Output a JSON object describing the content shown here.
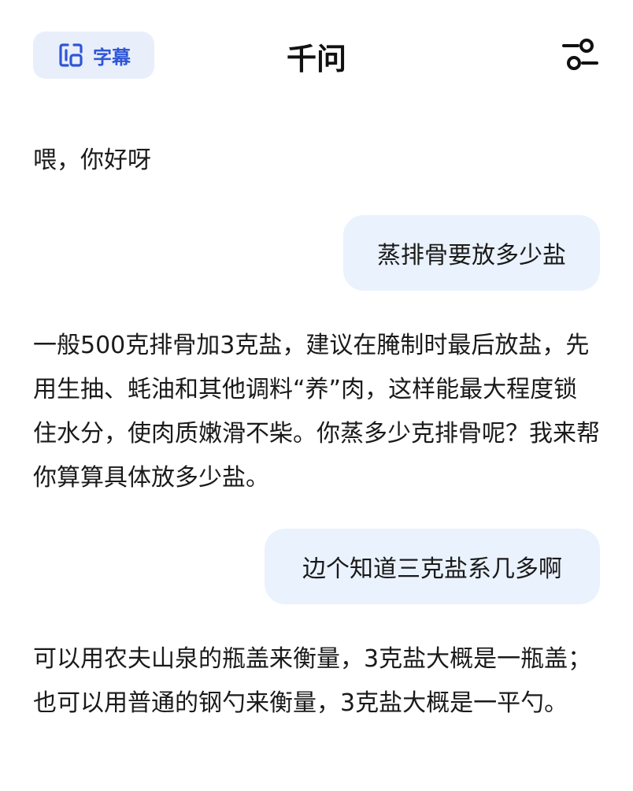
{
  "header": {
    "subtitle_label": "字幕",
    "title": "千问"
  },
  "messages": [
    {
      "role": "assistant",
      "text": "喂，你好呀"
    },
    {
      "role": "user",
      "text": "蒸排骨要放多少盐"
    },
    {
      "role": "assistant",
      "text": "一般500克排骨加3克盐，建议在腌制时最后放盐，先用生抽、蚝油和其他调料“养”肉，这样能最大程度锁住水分，使肉质嫩滑不柴。你蒸多少克排骨呢？我来帮你算算具体放多少盐。"
    },
    {
      "role": "user",
      "text": "边个知道三克盐系几多啊"
    },
    {
      "role": "assistant",
      "text": "可以用农夫山泉的瓶盖来衡量，3克盐大概是一瓶盖；也可以用普通的钢勺来衡量，3克盐大概是一平勺。"
    }
  ],
  "colors": {
    "accent": "#2e56d6",
    "subtitle_bg": "#e9eefb",
    "user_bubble_bg": "#eaf2fd"
  },
  "icons": {
    "subtitle": "subtitle-icon",
    "settings": "sliders-icon"
  }
}
